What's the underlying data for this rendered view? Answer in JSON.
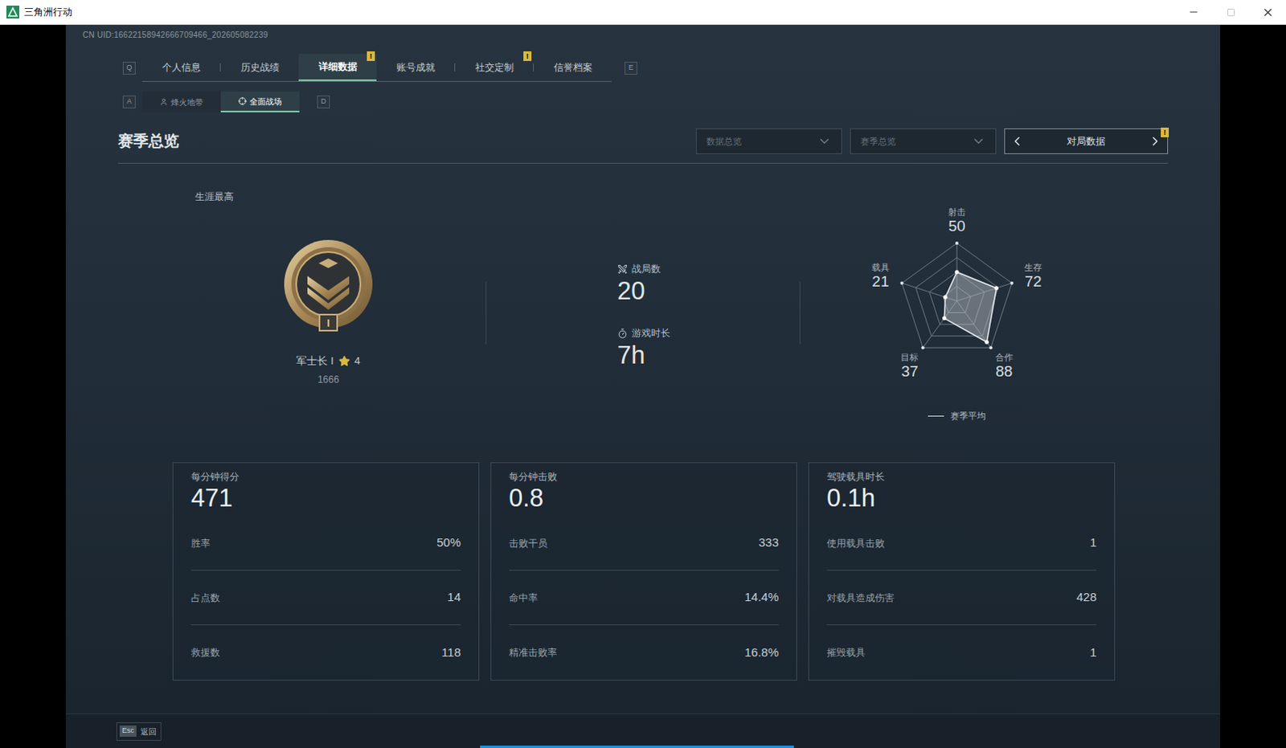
{
  "window": {
    "title": "三角洲行动"
  },
  "uid": "CN UID:16622158942666709466_202605082239",
  "tabs": {
    "prev_key": "Q",
    "next_key": "E",
    "items": [
      {
        "label": "个人信息",
        "selected": false,
        "badge": ""
      },
      {
        "label": "历史战绩",
        "selected": false,
        "badge": ""
      },
      {
        "label": "详细数据",
        "selected": true,
        "badge": "!"
      },
      {
        "label": "账号成就",
        "selected": false,
        "badge": ""
      },
      {
        "label": "社交定制",
        "selected": false,
        "badge": "!"
      },
      {
        "label": "信誉档案",
        "selected": false,
        "badge": ""
      }
    ]
  },
  "mode_tabs": {
    "prev_key": "A",
    "next_key": "D",
    "items": [
      {
        "label": "烽火地带",
        "selected": false
      },
      {
        "label": "全面战场",
        "selected": true
      }
    ]
  },
  "section_title": "赛季总览",
  "filters": [
    {
      "placeholder": "数据总览"
    },
    {
      "placeholder": "赛季总览"
    }
  ],
  "pager": {
    "label": "对局数据",
    "badge": "!"
  },
  "career": {
    "label": "生涯最高",
    "rank": "军士长 I",
    "badge_numeral": "I",
    "stars": "4",
    "score": "1666"
  },
  "matches": {
    "label": "战局数",
    "value": "20"
  },
  "playtime": {
    "label": "游戏时长",
    "value": "7h"
  },
  "radar": {
    "axes": [
      {
        "label": "射击",
        "value": "50"
      },
      {
        "label": "生存",
        "value": "72"
      },
      {
        "label": "合作",
        "value": "88"
      },
      {
        "label": "目标",
        "value": "37"
      },
      {
        "label": "载具",
        "value": "21"
      }
    ],
    "max": 100,
    "series": [
      {
        "name": "赛季平均",
        "values": [
          50,
          72,
          88,
          37,
          21
        ]
      }
    ]
  },
  "cards": [
    {
      "title": "每分钟得分",
      "value": "471",
      "rows": [
        {
          "label": "胜率",
          "value": "50%"
        },
        {
          "label": "占点数",
          "value": "14"
        },
        {
          "label": "救援数",
          "value": "118"
        }
      ]
    },
    {
      "title": "每分钟击败",
      "value": "0.8",
      "rows": [
        {
          "label": "击败干员",
          "value": "333"
        },
        {
          "label": "命中率",
          "value": "14.4%"
        },
        {
          "label": "精准击败率",
          "value": "16.8%"
        }
      ]
    },
    {
      "title": "驾驶载具时长",
      "value": "0.1h",
      "rows": [
        {
          "label": "使用载具击败",
          "value": "1"
        },
        {
          "label": "对载具造成伤害",
          "value": "428"
        },
        {
          "label": "摧毁载具",
          "value": "1"
        }
      ]
    }
  ],
  "footer": {
    "key": "Esc",
    "label": "返回"
  }
}
